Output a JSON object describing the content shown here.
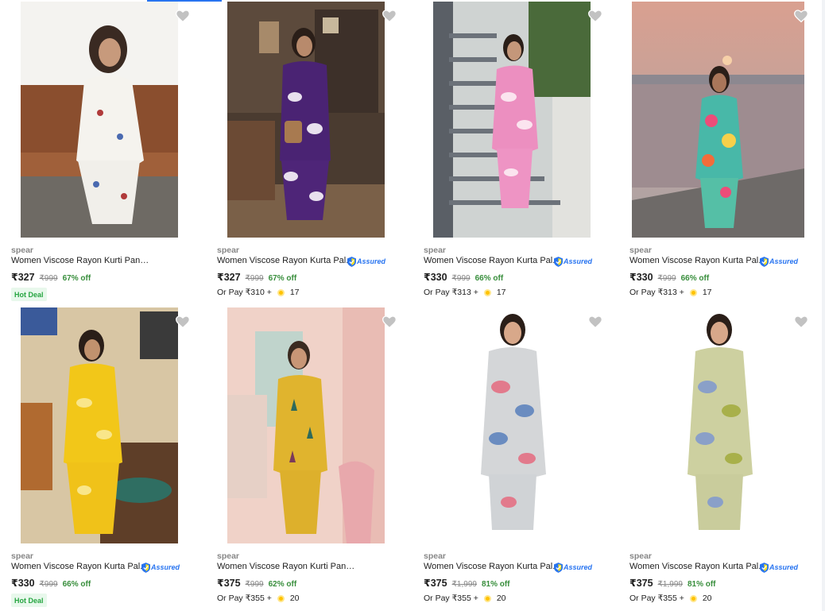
{
  "accent_color": "#2874f0",
  "products": [
    {
      "brand": "spear",
      "title": "Women Viscose Rayon Kurti Pant Set",
      "assured": false,
      "price": "₹327",
      "mrp": "₹999",
      "off": "67% off",
      "badge": "Hot Deal",
      "or_pay": null,
      "coins": null
    },
    {
      "brand": "spear",
      "title": "Women Viscose Rayon Kurta Pal...",
      "assured": true,
      "price": "₹327",
      "mrp": "₹999",
      "off": "67% off",
      "badge": null,
      "or_pay": "Or Pay ₹310 +",
      "coins": "17"
    },
    {
      "brand": "spear",
      "title": "Women Viscose Rayon Kurta Pal...",
      "assured": true,
      "price": "₹330",
      "mrp": "₹999",
      "off": "66% off",
      "badge": null,
      "or_pay": "Or Pay ₹313 +",
      "coins": "17"
    },
    {
      "brand": "spear",
      "title": "Women Viscose Rayon Kurta Pal...",
      "assured": true,
      "price": "₹330",
      "mrp": "₹999",
      "off": "66% off",
      "badge": null,
      "or_pay": "Or Pay ₹313 +",
      "coins": "17"
    },
    {
      "brand": "spear",
      "title": "Women Viscose Rayon Kurta Pal...",
      "assured": true,
      "price": "₹330",
      "mrp": "₹999",
      "off": "66% off",
      "badge": "Hot Deal",
      "or_pay": null,
      "coins": null
    },
    {
      "brand": "spear",
      "title": "Women Viscose Rayon Kurti Pant Set",
      "assured": false,
      "price": "₹375",
      "mrp": "₹999",
      "off": "62% off",
      "badge": null,
      "or_pay": "Or Pay ₹355 +",
      "coins": "20"
    },
    {
      "brand": "spear",
      "title": "Women Viscose Rayon Kurta Pal...",
      "assured": true,
      "price": "₹375",
      "mrp": "₹1,999",
      "off": "81% off",
      "badge": null,
      "or_pay": "Or Pay ₹355 +",
      "coins": "20"
    },
    {
      "brand": "spear",
      "title": "Women Viscose Rayon Kurta Pal...",
      "assured": true,
      "price": "₹375",
      "mrp": "₹1,999",
      "off": "81% off",
      "badge": null,
      "or_pay": "Or Pay ₹355 +",
      "coins": "20"
    }
  ],
  "assured_label": "Assured",
  "images": [
    {
      "scene": "cafe-bench",
      "outfit": "white-floral"
    },
    {
      "scene": "restaurant",
      "outfit": "purple-floral"
    },
    {
      "scene": "staircase",
      "outfit": "pink-floral"
    },
    {
      "scene": "riverside-sunset",
      "outfit": "multicolor-floral"
    },
    {
      "scene": "cafe-interior",
      "outfit": "yellow-floral"
    },
    {
      "scene": "pink-room",
      "outfit": "mustard-print"
    },
    {
      "scene": "studio-white",
      "outfit": "grey-floral"
    },
    {
      "scene": "studio-white",
      "outfit": "olive-floral"
    }
  ],
  "icons": {
    "wishlist": "heart-icon",
    "assured": "shield-check-icon",
    "coin": "coin-icon"
  }
}
